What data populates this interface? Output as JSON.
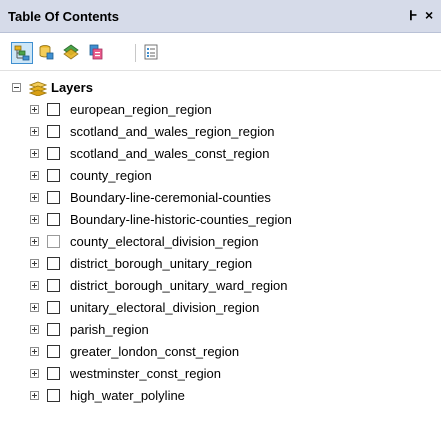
{
  "window": {
    "title": "Table Of Contents",
    "pin_glyph": "Ͱ",
    "close_glyph": "×"
  },
  "toolbar": {
    "buttons": [
      {
        "name": "list-by-drawing-order-icon",
        "active": true
      },
      {
        "name": "list-by-source-icon",
        "active": false
      },
      {
        "name": "list-by-visibility-icon",
        "active": false
      },
      {
        "name": "list-by-selection-icon",
        "active": false
      },
      {
        "name": "options-icon",
        "active": false
      }
    ]
  },
  "tree": {
    "root": {
      "label": "Layers",
      "icon": "layers-icon",
      "expanded": true
    },
    "layers": [
      {
        "label": "european_region_region",
        "checked": false
      },
      {
        "label": "scotland_and_wales_region_region",
        "checked": false
      },
      {
        "label": "scotland_and_wales_const_region",
        "checked": false
      },
      {
        "label": "county_region",
        "checked": false
      },
      {
        "label": "Boundary-line-ceremonial-counties",
        "checked": false
      },
      {
        "label": "Boundary-line-historic-counties_region",
        "checked": false
      },
      {
        "label": "county_electoral_division_region",
        "checked": false,
        "dimmed": true
      },
      {
        "label": "district_borough_unitary_region",
        "checked": false
      },
      {
        "label": "district_borough_unitary_ward_region",
        "checked": false
      },
      {
        "label": "unitary_electoral_division_region",
        "checked": false
      },
      {
        "label": "parish_region",
        "checked": false
      },
      {
        "label": "greater_london_const_region",
        "checked": false
      },
      {
        "label": "westminster_const_region",
        "checked": false
      },
      {
        "label": "high_water_polyline",
        "checked": false
      }
    ]
  },
  "colors": {
    "title_bar": "#d6dbe9",
    "active_button_bg": "#cde6f7",
    "active_button_border": "#3f8fd0",
    "layers_icon": "#e8b321"
  }
}
